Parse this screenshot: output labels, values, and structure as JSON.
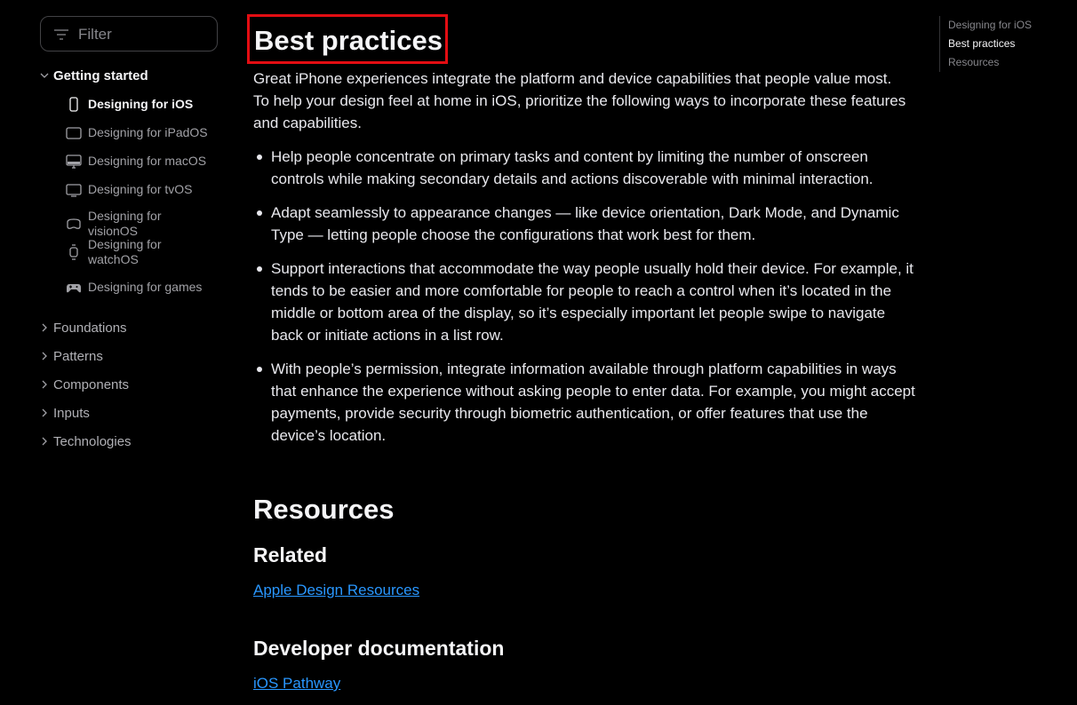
{
  "sidebar": {
    "filter_placeholder": "Filter",
    "sections": [
      {
        "label": "Getting started",
        "expanded": true
      },
      {
        "label": "Foundations",
        "expanded": false
      },
      {
        "label": "Patterns",
        "expanded": false
      },
      {
        "label": "Components",
        "expanded": false
      },
      {
        "label": "Inputs",
        "expanded": false
      },
      {
        "label": "Technologies",
        "expanded": false
      }
    ],
    "getting_started_items": [
      {
        "label": "Designing for iOS",
        "icon": "iphone-icon",
        "active": true
      },
      {
        "label": "Designing for iPadOS",
        "icon": "ipad-icon"
      },
      {
        "label": "Designing for macOS",
        "icon": "mac-display-icon"
      },
      {
        "label": "Designing for tvOS",
        "icon": "tv-icon"
      },
      {
        "label": "Designing for visionOS",
        "icon": "vision-pro-icon"
      },
      {
        "label": "Designing for watchOS",
        "icon": "watch-icon"
      },
      {
        "label": "Designing for games",
        "icon": "gamecontroller-icon"
      }
    ]
  },
  "main": {
    "section_title": "Best practices",
    "intro": "Great iPhone experiences integrate the platform and device capabilities that people value most. To help your design feel at home in iOS, prioritize the following ways to incorporate these features and capabilities.",
    "bullets": [
      "Help people concentrate on primary tasks and content by limiting the number of onscreen controls while making secondary details and actions discoverable with minimal interaction.",
      "Adapt seamlessly to appearance changes — like device orientation, Dark Mode, and Dynamic Type — letting people choose the configurations that work best for them.",
      "Support interactions that accommodate the way people usually hold their device. For example, it tends to be easier and more comfortable for people to reach a control when it’s located in the middle or bottom area of the display, so it’s especially important let people swipe to navigate back or initiate actions in a list row.",
      "With people’s permission, integrate information available through platform capabilities in ways that enhance the experience without asking people to enter data. For example, you might accept payments, provide security through biometric authentication, or offer features that use the device’s location."
    ],
    "resources_title": "Resources",
    "related_title": "Related",
    "related_link": "Apple Design Resources",
    "devdoc_title": "Developer documentation",
    "devdoc_link": "iOS Pathway"
  },
  "toc": {
    "items": [
      "Designing for iOS",
      "Best practices",
      "Resources"
    ],
    "current_index": 1
  },
  "colors": {
    "background": "#000000",
    "link": "#2997ff",
    "highlight_border": "#e30d12"
  }
}
